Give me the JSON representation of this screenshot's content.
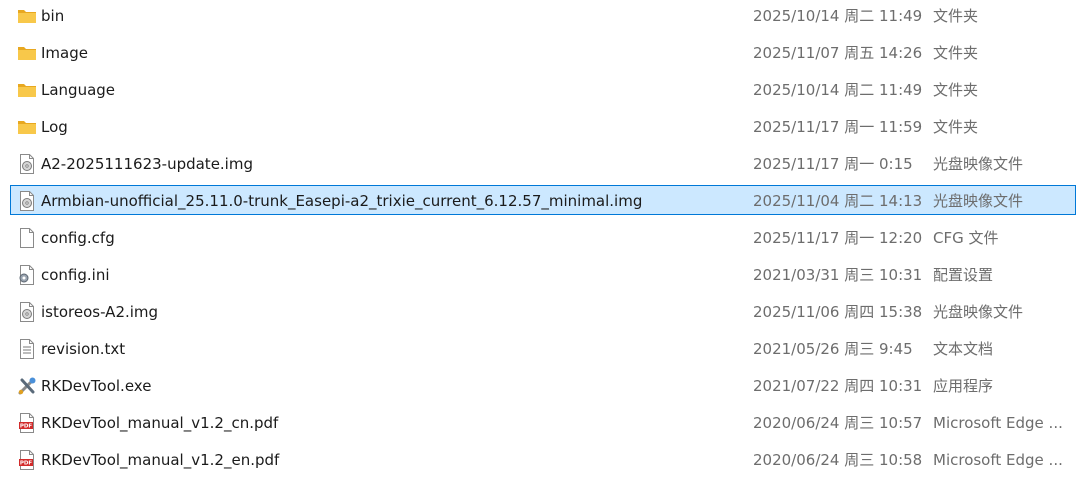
{
  "files": [
    {
      "name": "bin",
      "date": "2025/10/14 周二 11:49",
      "type": "文件夹",
      "icon": "folder-icon"
    },
    {
      "name": "Image",
      "date": "2025/11/07 周五 14:26",
      "type": "文件夹",
      "icon": "folder-icon"
    },
    {
      "name": "Language",
      "date": "2025/10/14 周二 11:49",
      "type": "文件夹",
      "icon": "folder-icon"
    },
    {
      "name": "Log",
      "date": "2025/11/17 周一 11:59",
      "type": "文件夹",
      "icon": "folder-icon"
    },
    {
      "name": "A2-2025111623-update.img",
      "date": "2025/11/17 周一 0:15",
      "type": "光盘映像文件",
      "icon": "disc-image-icon"
    },
    {
      "name": "Armbian-unofficial_25.11.0-trunk_Easepi-a2_trixie_current_6.12.57_minimal.img",
      "date": "2025/11/04 周二 14:13",
      "type": "光盘映像文件",
      "icon": "disc-image-icon",
      "selected": true
    },
    {
      "name": "config.cfg",
      "date": "2025/11/17 周一 12:20",
      "type": "CFG 文件",
      "icon": "file-icon"
    },
    {
      "name": "config.ini",
      "date": "2021/03/31 周三 10:31",
      "type": "配置设置",
      "icon": "settings-file-icon"
    },
    {
      "name": "istoreos-A2.img",
      "date": "2025/11/06 周四 15:38",
      "type": "光盘映像文件",
      "icon": "disc-image-icon"
    },
    {
      "name": "revision.txt",
      "date": "2021/05/26 周三 9:45",
      "type": "文本文档",
      "icon": "text-file-icon"
    },
    {
      "name": "RKDevTool.exe",
      "date": "2021/07/22 周四 10:31",
      "type": "应用程序",
      "icon": "tools-exe-icon"
    },
    {
      "name": "RKDevTool_manual_v1.2_cn.pdf",
      "date": "2020/06/24 周三 10:57",
      "type": "Microsoft Edge ...",
      "icon": "pdf-icon"
    },
    {
      "name": "RKDevTool_manual_v1.2_en.pdf",
      "date": "2020/06/24 周三 10:58",
      "type": "Microsoft Edge ...",
      "icon": "pdf-icon"
    }
  ],
  "colors": {
    "selection_bg": "#cce8ff",
    "selection_border": "#0078d7",
    "folder": "#f8c84a",
    "pdf": "#d22b2b"
  }
}
